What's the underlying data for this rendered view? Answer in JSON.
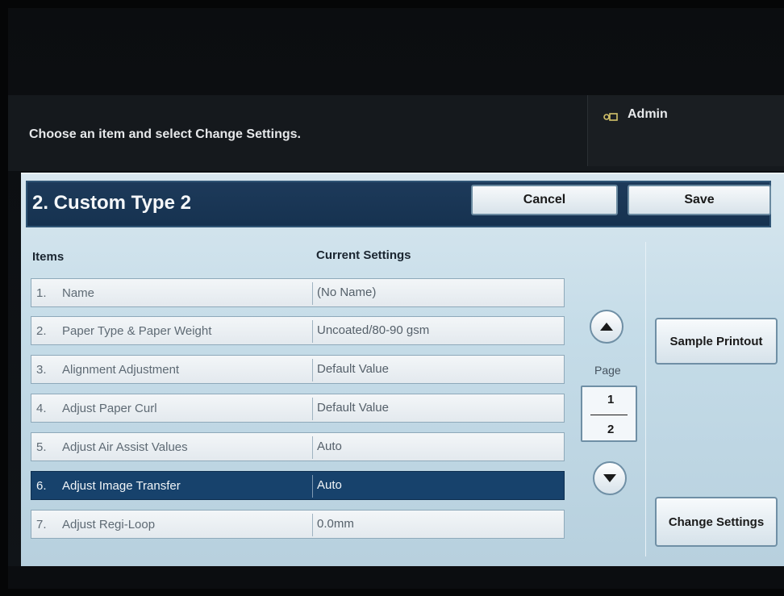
{
  "message": "Choose an item and select Change Settings.",
  "admin": {
    "label": "Admin",
    "icon": "key-icon"
  },
  "title": "2. Custom Type 2",
  "buttons": {
    "cancel": "Cancel",
    "save": "Save",
    "sample_printout": "Sample Printout",
    "change_settings": "Change Settings"
  },
  "headers": {
    "items": "Items",
    "current_settings": "Current Settings"
  },
  "rows": [
    {
      "num": "1.",
      "name": "Name",
      "value": "(No Name)"
    },
    {
      "num": "2.",
      "name": "Paper Type & Paper Weight",
      "value": "Uncoated/80-90 gsm"
    },
    {
      "num": "3.",
      "name": "Alignment Adjustment",
      "value": "Default Value"
    },
    {
      "num": "4.",
      "name": "Adjust Paper Curl",
      "value": "Default Value"
    },
    {
      "num": "5.",
      "name": "Adjust Air Assist Values",
      "value": "Auto"
    },
    {
      "num": "6.",
      "name": "Adjust Image Transfer",
      "value": "Auto"
    },
    {
      "num": "7.",
      "name": "Adjust Regi-Loop",
      "value": "0.0mm"
    }
  ],
  "selected_row": 6,
  "pager": {
    "label": "Page",
    "current": "1",
    "total": "2"
  },
  "colors": {
    "accent": "#17426c",
    "title_bar": "#1d3a5a"
  }
}
